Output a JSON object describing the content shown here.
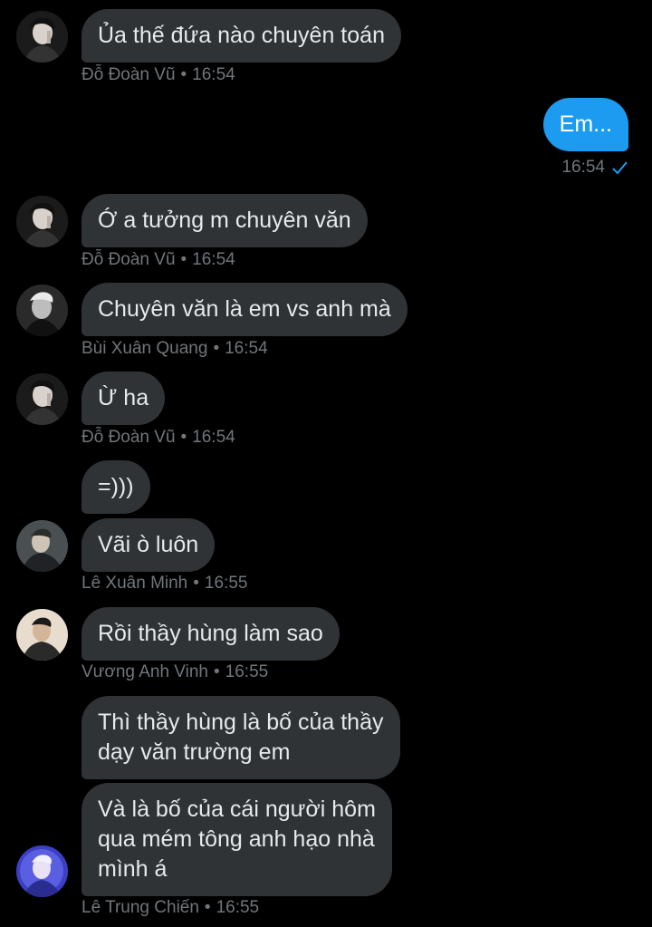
{
  "messages": [
    {
      "text": "Ủa thế đứa nào chuyên toán",
      "sender": "Đỗ Đoàn Vũ",
      "time": "16:54"
    },
    {
      "text": "Em...",
      "time": "16:54",
      "status_icon": "check-icon"
    },
    {
      "text": "Ớ a tưởng m chuyên văn",
      "sender": "Đỗ Đoàn Vũ",
      "time": "16:54"
    },
    {
      "text": "Chuyên văn là em vs anh mà",
      "sender": "Bùi Xuân Quang",
      "time": "16:54"
    },
    {
      "text": "Ừ ha",
      "sender": "Đỗ Đoàn Vũ",
      "time": "16:54"
    },
    {
      "text": "=)))",
      "sender": "Lê Xuân Minh",
      "time": "16:55"
    },
    {
      "text": "Vãi ò luôn",
      "sender": "Lê Xuân Minh",
      "time": "16:55"
    },
    {
      "text": "Rồi thầy hùng làm sao",
      "sender": "Vương Anh Vinh",
      "time": "16:55"
    },
    {
      "text": "Thì thầy hùng là bố của thầy\ndạy văn trường em",
      "sender": "Lê Trung Chiến",
      "time": "16:55"
    },
    {
      "text": "Và là bố của cái người hôm\nqua mém tông anh hạo nhà\nmình á",
      "sender": "Lê Trung Chiến",
      "time": "16:55"
    }
  ],
  "meta_separator": "•",
  "colors": {
    "background": "#000000",
    "bubble_other": "#2f3336",
    "bubble_me": "#1d9bf0",
    "text": "#e7e9ea",
    "meta": "#71767b",
    "check": "#1d9bf0"
  }
}
